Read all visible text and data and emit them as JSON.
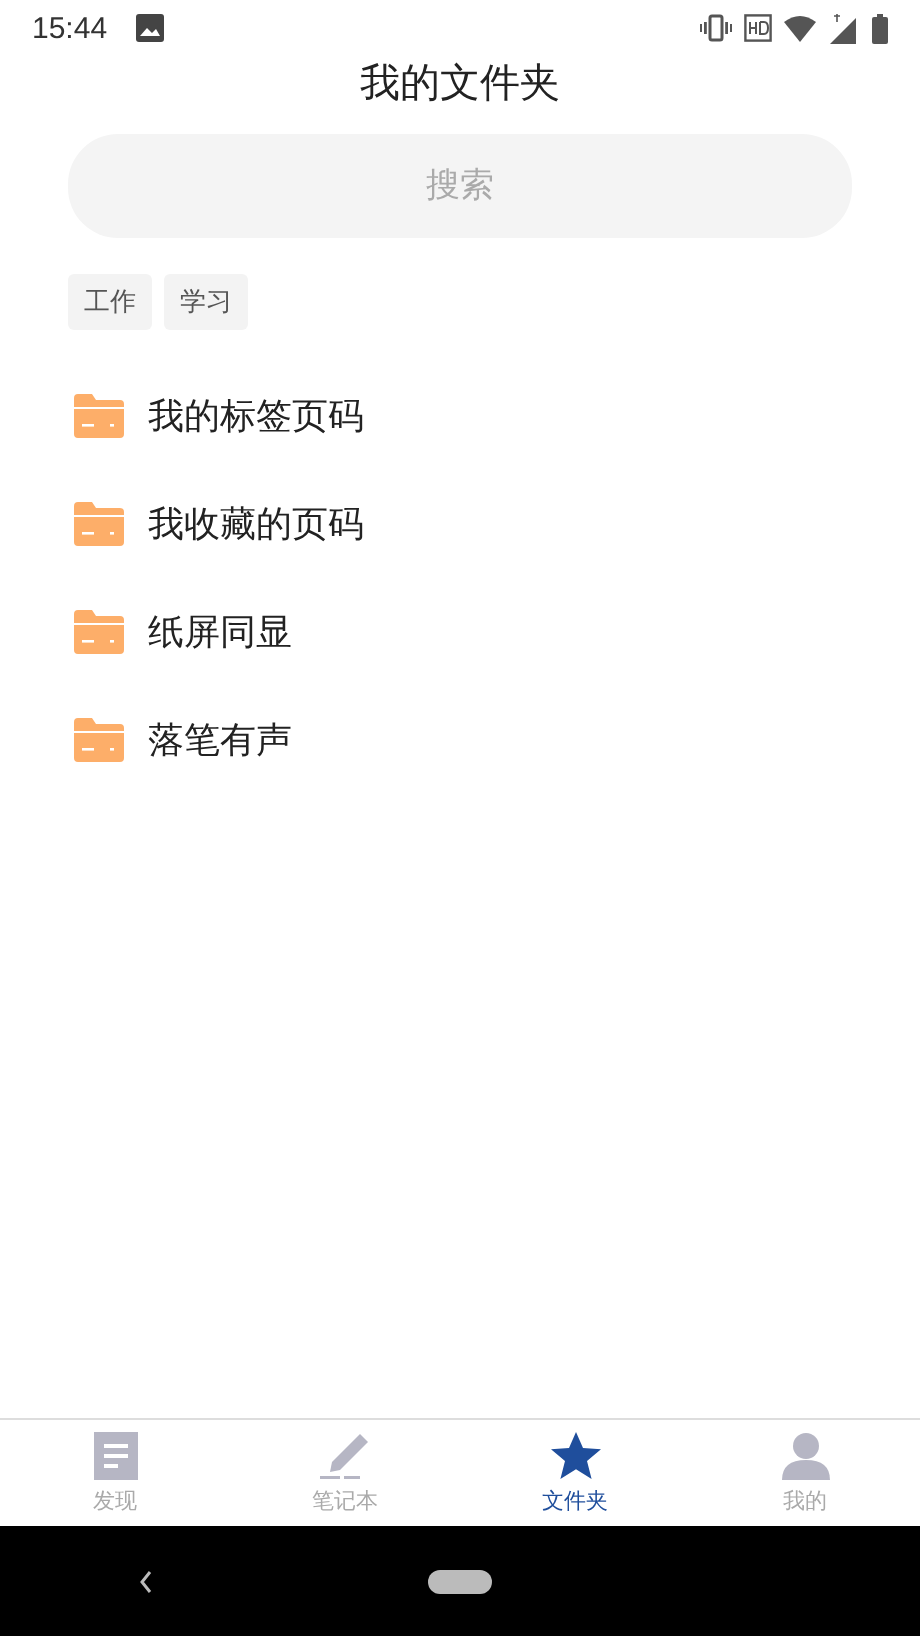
{
  "status_bar": {
    "time": "15:44"
  },
  "title": "我的文件夹",
  "search": {
    "placeholder": "搜索"
  },
  "tags": [
    {
      "label": "工作"
    },
    {
      "label": "学习"
    }
  ],
  "folders": [
    {
      "name": "我的标签页码"
    },
    {
      "name": "我收藏的页码"
    },
    {
      "name": "纸屏同显"
    },
    {
      "name": "落笔有声"
    }
  ],
  "tab_bar": [
    {
      "label": "发现",
      "kind": "doc",
      "selected": false
    },
    {
      "label": "笔记本",
      "kind": "pen",
      "selected": false
    },
    {
      "label": "文件夹",
      "kind": "star",
      "selected": true
    },
    {
      "label": "我的",
      "kind": "person",
      "selected": false
    }
  ]
}
